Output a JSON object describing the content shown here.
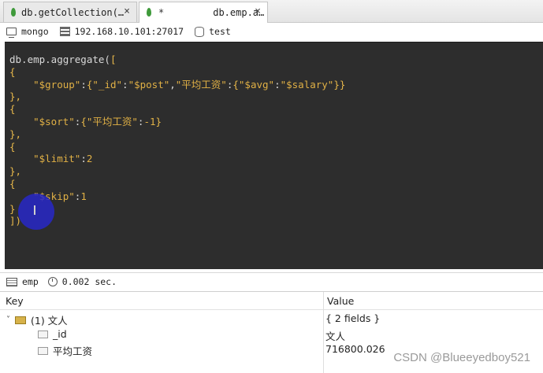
{
  "tabs": [
    {
      "label": "db.getCollection(…",
      "close": "×"
    },
    {
      "label": "db.emp.a…",
      "marker": "*",
      "close": "×"
    }
  ],
  "connection": {
    "server": "mongo",
    "address": "192.168.10.101:27017",
    "database": "test"
  },
  "editor": {
    "lines": [
      [
        {
          "t": "db.emp.aggregate(",
          "c": "kw"
        },
        {
          "t": "[",
          "c": "br"
        }
      ],
      [
        {
          "t": "{",
          "c": "br"
        }
      ],
      [
        {
          "t": "    ",
          "c": "kw"
        },
        {
          "t": "\"$group\"",
          "c": "str"
        },
        {
          "t": ":",
          "c": "kw"
        },
        {
          "t": "{",
          "c": "br"
        },
        {
          "t": "\"_id\"",
          "c": "str"
        },
        {
          "t": ":",
          "c": "kw"
        },
        {
          "t": "\"$post\"",
          "c": "str"
        },
        {
          "t": ",",
          "c": "kw"
        },
        {
          "t": "\"平均工资\"",
          "c": "str"
        },
        {
          "t": ":",
          "c": "kw"
        },
        {
          "t": "{",
          "c": "br"
        },
        {
          "t": "\"$avg\"",
          "c": "str"
        },
        {
          "t": ":",
          "c": "kw"
        },
        {
          "t": "\"$salary\"",
          "c": "str"
        },
        {
          "t": "}}",
          "c": "br"
        }
      ],
      [
        {
          "t": "},",
          "c": "br"
        }
      ],
      [
        {
          "t": "{",
          "c": "br"
        }
      ],
      [
        {
          "t": "    ",
          "c": "kw"
        },
        {
          "t": "\"$sort\"",
          "c": "str"
        },
        {
          "t": ":",
          "c": "kw"
        },
        {
          "t": "{",
          "c": "br"
        },
        {
          "t": "\"平均工资\"",
          "c": "str"
        },
        {
          "t": ":",
          "c": "kw"
        },
        {
          "t": "-1",
          "c": "num"
        },
        {
          "t": "}",
          "c": "br"
        }
      ],
      [
        {
          "t": "},",
          "c": "br"
        }
      ],
      [
        {
          "t": "{",
          "c": "br"
        }
      ],
      [
        {
          "t": "    ",
          "c": "kw"
        },
        {
          "t": "\"$limit\"",
          "c": "str"
        },
        {
          "t": ":",
          "c": "kw"
        },
        {
          "t": "2",
          "c": "num"
        }
      ],
      [
        {
          "t": "},",
          "c": "br"
        }
      ],
      [
        {
          "t": "{",
          "c": "br"
        }
      ],
      [
        {
          "t": "    ",
          "c": "kw"
        },
        {
          "t": "\"$skip\"",
          "c": "str"
        },
        {
          "t": ":",
          "c": "kw"
        },
        {
          "t": "1",
          "c": "num"
        }
      ],
      [
        {
          "t": "}",
          "c": "br"
        }
      ],
      [
        {
          "t": "])",
          "c": "br"
        }
      ]
    ]
  },
  "results_status": {
    "collection": "emp",
    "time": "0.002 sec."
  },
  "tree": {
    "headers": {
      "key": "Key",
      "value": "Value"
    },
    "rows": [
      {
        "key": "(1) 文人",
        "value": "{ 2 fields }",
        "level": 0,
        "icon": "document-icon",
        "expanded": true
      },
      {
        "key": "_id",
        "value": "文人",
        "level": 1,
        "icon": "string-field-icon"
      },
      {
        "key": "平均工资",
        "value": "716800.026",
        "level": 1,
        "icon": "number-field-icon"
      }
    ]
  },
  "watermark": "CSDN @Blueeyedboy521",
  "colors": {
    "editor_bg": "#2d2d2d",
    "string": "#e0b045",
    "brace": "#e8b84a",
    "cursor": "#2828c8"
  }
}
